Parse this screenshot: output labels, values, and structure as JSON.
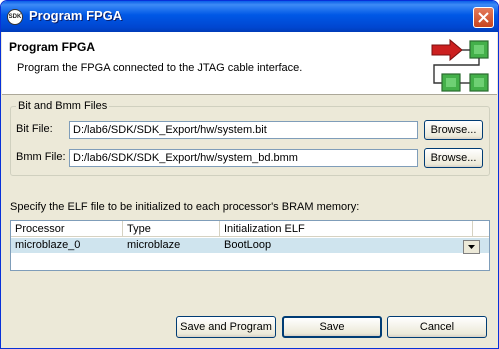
{
  "window": {
    "title": "Program FPGA",
    "app_icon_text": "SDK"
  },
  "header": {
    "title": "Program FPGA",
    "description": "Program the FPGA connected to the JTAG cable interface."
  },
  "files_group": {
    "legend": "Bit and Bmm Files",
    "bit_label": "Bit File:",
    "bit_value": "D:/lab6/SDK/SDK_Export/hw/system.bit",
    "bmm_label": "Bmm File:",
    "bmm_value": "D:/lab6/SDK/SDK_Export/hw/system_bd.bmm",
    "browse_label": "Browse..."
  },
  "elf_section": {
    "label": "Specify the ELF file to be initialized to each processor's BRAM memory:",
    "columns": [
      "Processor",
      "Type",
      "Initialization ELF"
    ],
    "rows": [
      {
        "processor": "microblaze_0",
        "type": "microblaze",
        "elf": "BootLoop"
      }
    ]
  },
  "buttons": {
    "save_and_program": "Save and Program",
    "save": "Save",
    "cancel": "Cancel"
  },
  "colors": {
    "titlebar": "#0058e6",
    "arrow_red": "#cc2020",
    "node_green": "#44b04a",
    "selected_row": "#cfe4ee"
  },
  "icons": {
    "header_graphic": "fpga-program-graphic",
    "close": "close-icon",
    "dropdown": "chevron-down-icon"
  }
}
